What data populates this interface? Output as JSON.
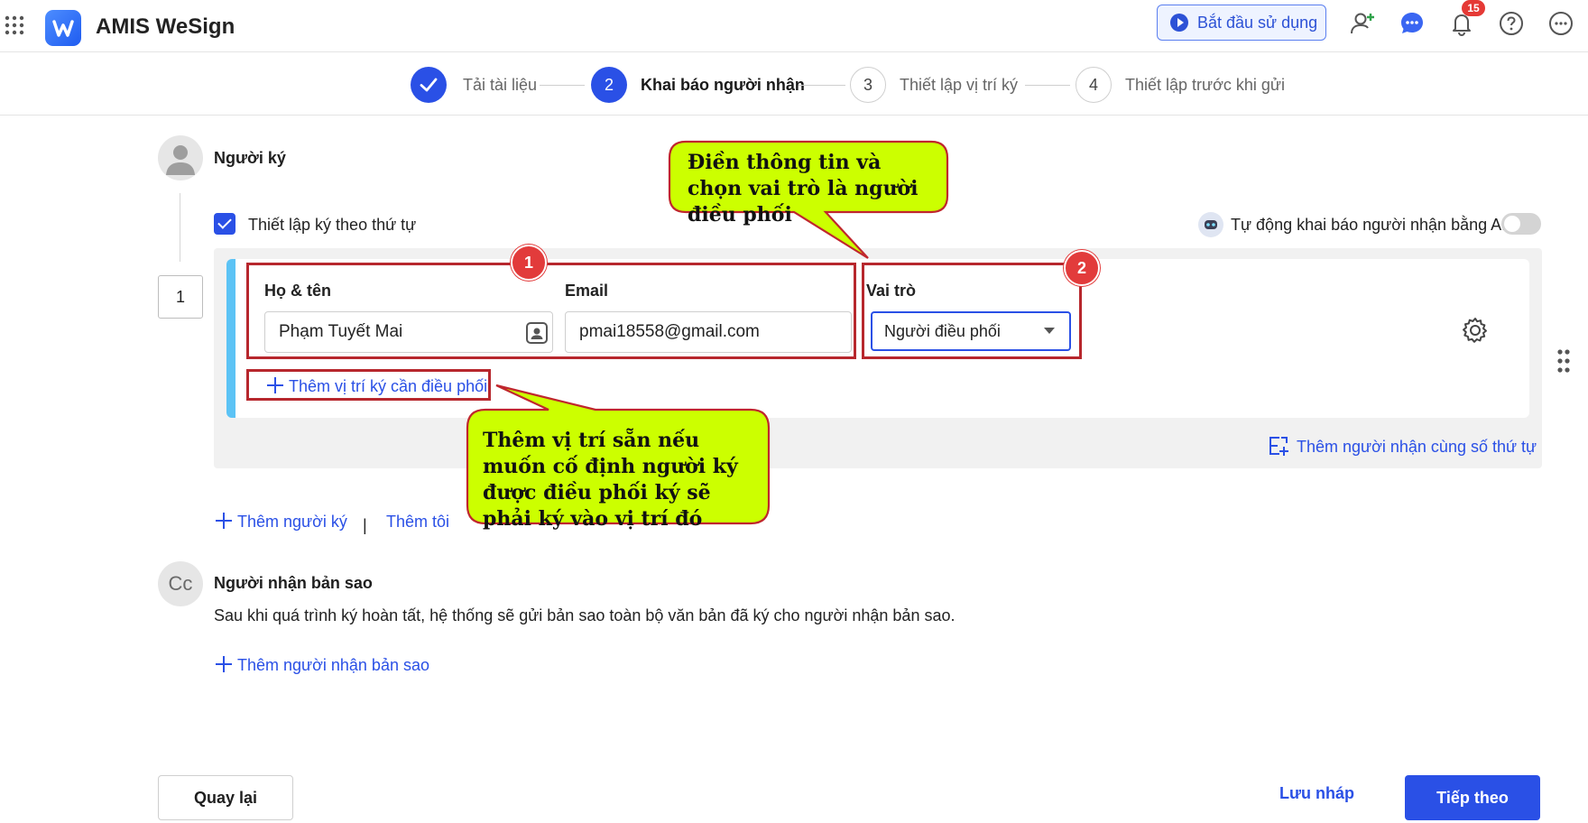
{
  "app": {
    "title": "AMIS WeSign"
  },
  "header": {
    "start_label": "Bắt đầu sử dụng",
    "notification_count": "15",
    "icons": [
      "apps-grid-icon",
      "add-user-icon",
      "chat-icon",
      "bell-icon",
      "help-icon",
      "more-icon"
    ]
  },
  "stepper": {
    "steps": [
      {
        "number": "",
        "label": "Tải tài liệu",
        "state": "done"
      },
      {
        "number": "2",
        "label": "Khai báo người nhận",
        "state": "active"
      },
      {
        "number": "3",
        "label": "Thiết lập vị trí ký",
        "state": "todo"
      },
      {
        "number": "4",
        "label": "Thiết lập trước khi gửi",
        "state": "todo"
      }
    ]
  },
  "signers": {
    "title": "Người ký",
    "sequential_label": "Thiết lập ký theo thứ tự",
    "sequential_checked": true,
    "ai_label": "Tự động khai báo người nhận bằng AI",
    "ai_enabled": false,
    "order": "1",
    "name_label": "Họ & tên",
    "name_value": "Phạm Tuyết Mai",
    "email_label": "Email",
    "email_value": "pmai18558@gmail.com",
    "role_label": "Vai trò",
    "role_value": "Người điều phối",
    "add_position_link": "Thêm vị trí ký cần điều phối",
    "add_same_order_link": "Thêm người nhận cùng số thứ tự",
    "add_signer_link": "Thêm người ký",
    "separator": "|",
    "add_me_link": "Thêm tôi"
  },
  "annotations": {
    "badge1": "1",
    "badge2": "2",
    "callout_top": "Điền thông tin và chọn vai trò là người điều phối",
    "callout_bottom": "Thêm vị trí sẵn nếu muốn cố định người ký được điều phối ký sẽ phải ký vào vị trí đó",
    "callout_fill": "#ccff00",
    "callout_border": "#c0262d"
  },
  "cc": {
    "avatar_text": "Cc",
    "title": "Người nhận bản sao",
    "description": "Sau khi quá trình ký hoàn tất, hệ thống sẽ gửi bản sao toàn bộ văn bản đã ký cho người nhận bản sao.",
    "add_link": "Thêm người nhận bản sao"
  },
  "footer": {
    "back_label": "Quay lại",
    "draft_label": "Lưu nháp",
    "next_label": "Tiếp theo"
  },
  "colors": {
    "primary": "#2a50e6",
    "accent_bar": "#5cc3f5",
    "annotation_red": "#b7272d"
  }
}
